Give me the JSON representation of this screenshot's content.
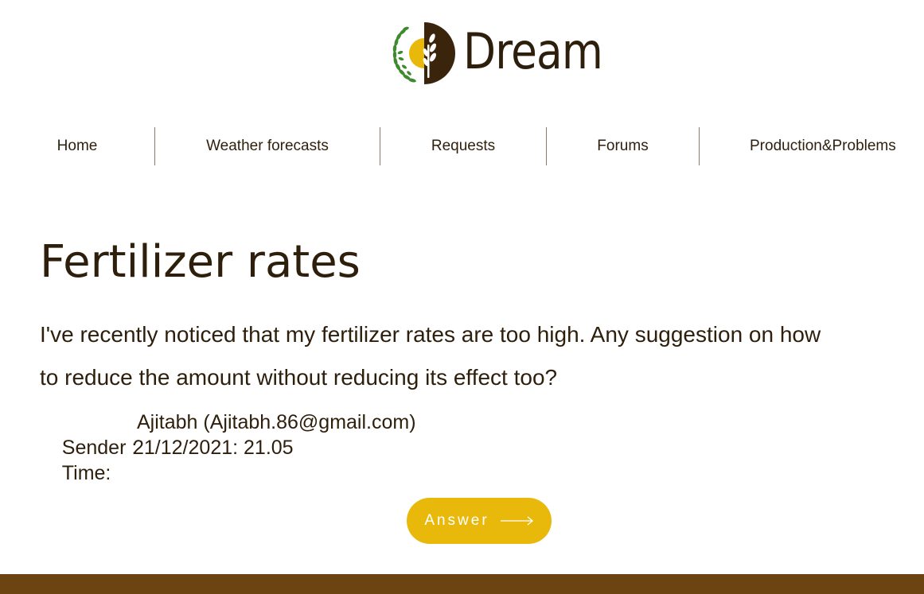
{
  "brand": {
    "name": "Dream",
    "logo_icon": "wheat-sun-logo-icon",
    "colors": {
      "leaf": "#3f8a2e",
      "sun": "#e8b90b",
      "dark": "#3a240c"
    }
  },
  "nav": {
    "items": [
      {
        "label": "Home"
      },
      {
        "label": "Weather forecasts"
      },
      {
        "label": "Requests"
      },
      {
        "label": "Forums"
      },
      {
        "label": "Production&Problems"
      }
    ]
  },
  "post": {
    "title": "Fertilizer rates",
    "body": "I've recently noticed that my fertilizer rates are too high. Any suggestion on how to reduce the amount without reducing its effect too?",
    "sender_label": "Sender :",
    "sender_value": "Ajitabh (Ajitabh.86@gmail.com)",
    "time_label": "Time:",
    "time_value": "21/12/2021: 21.05"
  },
  "actions": {
    "answer_label": "Answer",
    "answer_icon": "arrow-right-icon",
    "button_color": "#e8b90b"
  },
  "footer": {
    "color": "#6b4412"
  }
}
